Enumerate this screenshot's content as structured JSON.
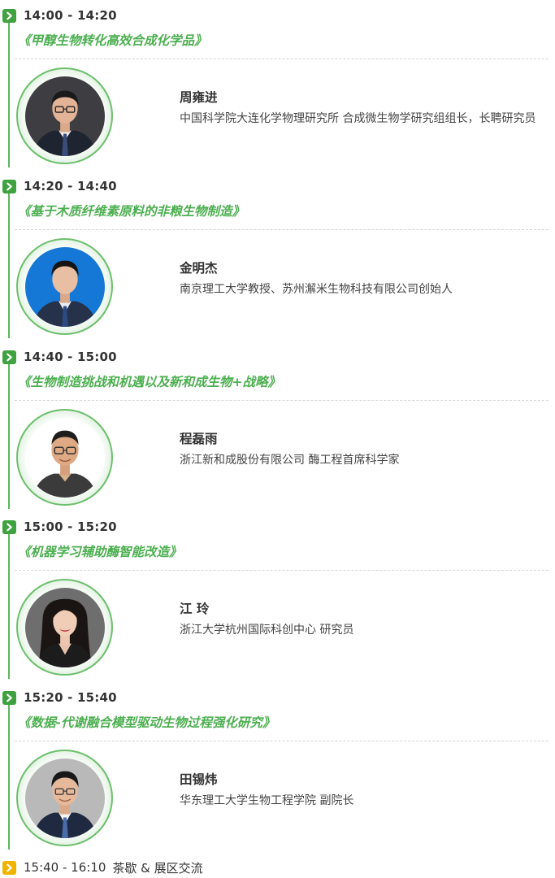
{
  "sessions": [
    {
      "time": "14:00 - 14:20",
      "title": "《甲醇生物转化高效合成化学品》",
      "speaker_name": "周雍进",
      "speaker_title": "中国科学院大连化学物理研究所 合成微生物学研究组组长，长聘研究员"
    },
    {
      "time": "14:20 - 14:40",
      "title": "《基于木质纤维素原料的非粮生物制造》",
      "speaker_name": "金明杰",
      "speaker_title": "南京理工大学教授、苏州澥米生物科技有限公司创始人"
    },
    {
      "time": "14:40 - 15:00",
      "title": "《生物制造挑战和机遇以及新和成生物+战略》",
      "speaker_name": "程磊雨",
      "speaker_title": "浙江新和成股份有限公司 酶工程首席科学家"
    },
    {
      "time": "15:00 - 15:20",
      "title": "《机器学习辅助酶智能改造》",
      "speaker_name": "江 玲",
      "speaker_title": "浙江大学杭州国际科创中心 研究员"
    },
    {
      "time": "15:20 - 15:40",
      "title": "《数据-代谢融合模型驱动生物过程强化研究》",
      "speaker_name": "田锡炜",
      "speaker_title": "华东理工大学生物工程学院 副院长"
    }
  ],
  "break": {
    "time": "15:40 - 16:10",
    "label": "茶歇 & 展区交流"
  },
  "colors": {
    "accent_green": "#4caf50",
    "rail_green": "#5cb85c",
    "break_yellow": "#f0b400"
  }
}
